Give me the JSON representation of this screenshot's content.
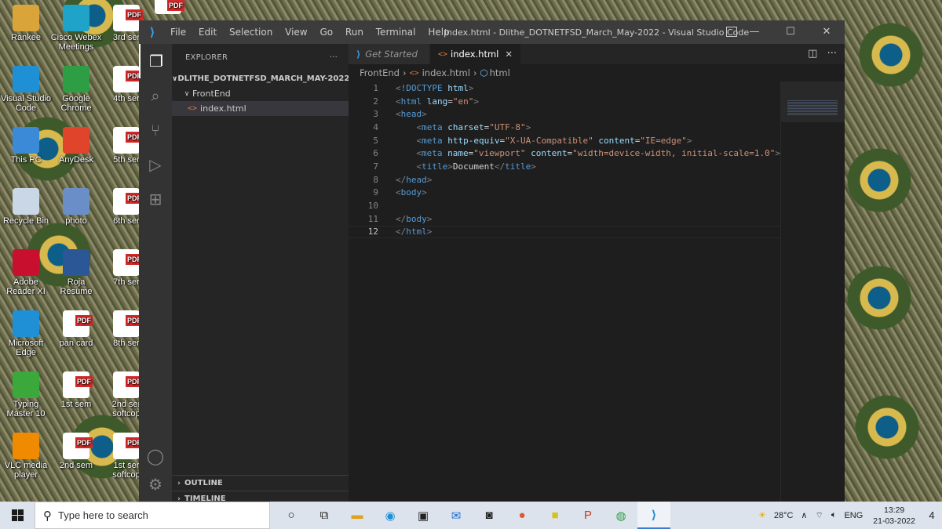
{
  "desktop": {
    "icons": [
      {
        "label": "Rankee",
        "icon": "folder-icon"
      },
      {
        "label": "Cisco Webex Meetings",
        "icon": "webex-icon"
      },
      {
        "label": "3rd ser",
        "icon": "pdf-icon"
      },
      {
        "label": "Visual Studio Code",
        "icon": "vscode-icon"
      },
      {
        "label": "Google Chrome",
        "icon": "chrome-icon"
      },
      {
        "label": "4th ser",
        "icon": "pdf-icon"
      },
      {
        "label": "This PC",
        "icon": "pc-icon"
      },
      {
        "label": "AnyDesk",
        "icon": "anydesk-icon"
      },
      {
        "label": "5th ser",
        "icon": "pdf-icon"
      },
      {
        "label": "Recycle Bin",
        "icon": "recycle-bin-icon"
      },
      {
        "label": "photo",
        "icon": "photo-icon"
      },
      {
        "label": "6th ser",
        "icon": "pdf-icon"
      },
      {
        "label": "Adobe Reader XI",
        "icon": "adobe-reader-icon"
      },
      {
        "label": "Roja Resume",
        "icon": "word-document-icon"
      },
      {
        "label": "7th ser",
        "icon": "pdf-icon"
      },
      {
        "label": "Microsoft Edge",
        "icon": "edge-icon"
      },
      {
        "label": "pan card",
        "icon": "pdf-icon"
      },
      {
        "label": "8th ser",
        "icon": "pdf-icon"
      },
      {
        "label": "Typing Master 10",
        "icon": "typing-master-icon"
      },
      {
        "label": "1st sem",
        "icon": "pdf-icon"
      },
      {
        "label": "2nd ser softcop",
        "icon": "pdf-icon"
      },
      {
        "label": "VLC media player",
        "icon": "vlc-icon"
      },
      {
        "label": "2nd sem",
        "icon": "pdf-icon"
      },
      {
        "label": "1st ser softcop",
        "icon": "pdf-icon"
      }
    ],
    "top_pdf_label": "PDF"
  },
  "window": {
    "menu": [
      "File",
      "Edit",
      "Selection",
      "View",
      "Go",
      "Run",
      "Terminal",
      "Help"
    ],
    "title": "index.html - Dlithe_DOTNETFSD_March_May-2022 - Visual Studio Code",
    "controls": {
      "minimize": "—",
      "maximize": "☐",
      "close": "✕"
    }
  },
  "explorer": {
    "header": "EXPLORER",
    "more": "···",
    "workspace": "DLITHE_DOTNETFSD_MARCH_MAY-2022",
    "folder": "FrontEnd",
    "file": "index.html",
    "outline": "OUTLINE",
    "timeline": "TIMELINE"
  },
  "tabs": [
    {
      "label": "Get Started",
      "active": false
    },
    {
      "label": "index.html",
      "active": true
    }
  ],
  "breadcrumb": [
    "FrontEnd",
    "index.html",
    "html"
  ],
  "code": {
    "current_line": 12,
    "lines": [
      {
        "n": "1",
        "text": "<!DOCTYPE html>"
      },
      {
        "n": "2",
        "text": "<html lang=\"en\">"
      },
      {
        "n": "3",
        "text": "<head>"
      },
      {
        "n": "4",
        "text": "    <meta charset=\"UTF-8\">"
      },
      {
        "n": "5",
        "text": "    <meta http-equiv=\"X-UA-Compatible\" content=\"IE=edge\">"
      },
      {
        "n": "6",
        "text": "    <meta name=\"viewport\" content=\"width=device-width, initial-scale=1.0\">"
      },
      {
        "n": "7",
        "text": "    <title>Document</title>"
      },
      {
        "n": "8",
        "text": "</head>"
      },
      {
        "n": "9",
        "text": "<body>"
      },
      {
        "n": "10",
        "text": ""
      },
      {
        "n": "11",
        "text": "</body>"
      },
      {
        "n": "12",
        "text": "</html>"
      }
    ]
  },
  "taskbar": {
    "search_placeholder": "Type here to search",
    "weather": "28°C",
    "language": "ENG",
    "time": "13:29",
    "date": "21-03-2022",
    "notifications": "4"
  },
  "colors": {
    "editor_bg": "#1e1e1e",
    "sidebar_bg": "#252526",
    "activity_bg": "#333333",
    "titlebar_bg": "#3c3c3c",
    "tag": "#569cd6",
    "attr": "#9cdcfe",
    "string": "#ce9178",
    "vscode_blue": "#3aa0e8"
  }
}
